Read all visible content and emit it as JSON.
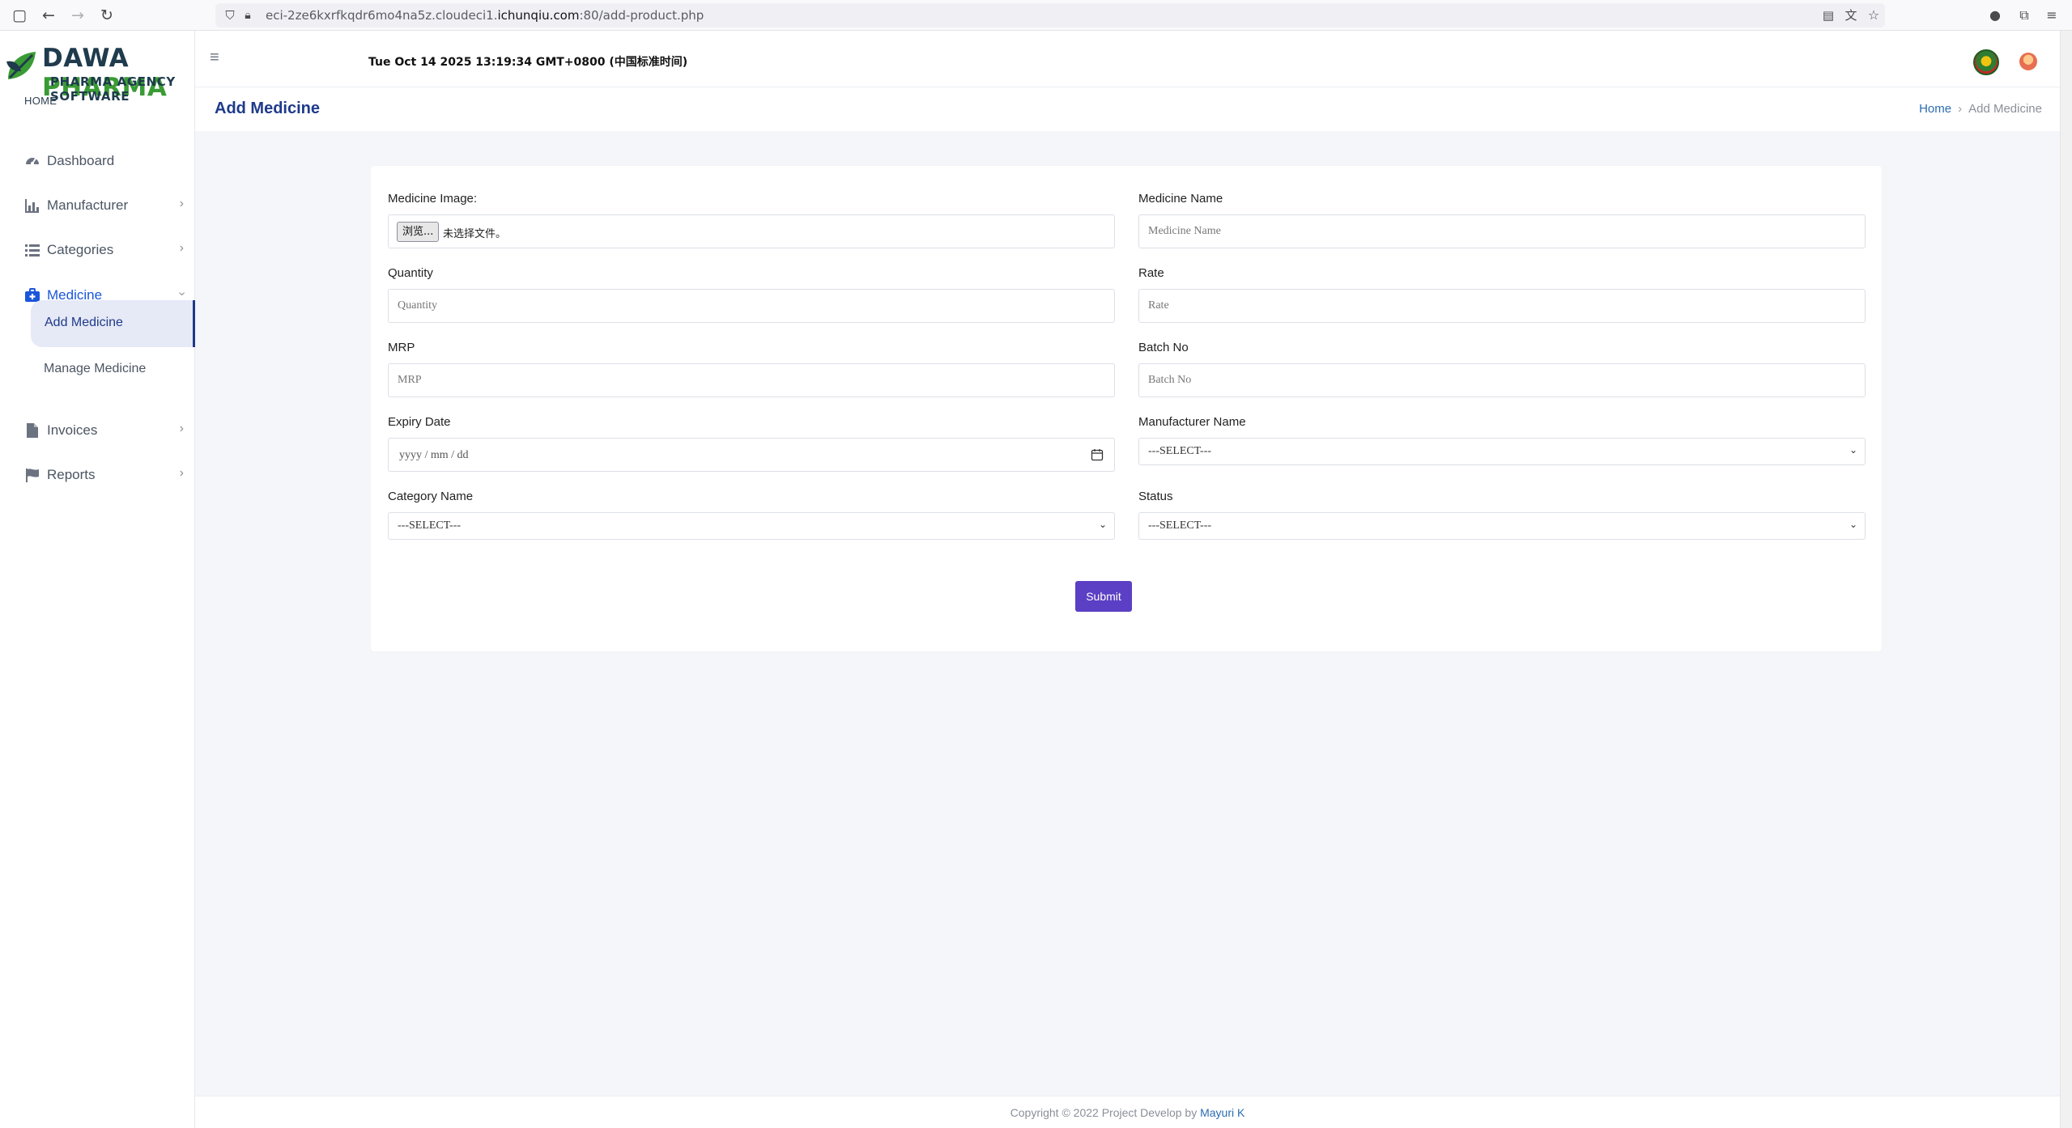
{
  "browser": {
    "url_prefix": "eci-2ze6kxrfkqdr6mo4na5z.cloudeci1.",
    "url_domain": "ichunqiu.com",
    "url_suffix": ":80/add-product.php"
  },
  "brand": {
    "name_part1": "DAWA",
    "name_part2": "PHARMA",
    "tagline": "PHARMA AGENCY SOFTWARE"
  },
  "header": {
    "datetime": "Tue Oct 14 2025 13:19:34 GMT+0800 (中国标准时间)"
  },
  "sidebar": {
    "heading": "HOME",
    "items": [
      {
        "label": "Dashboard",
        "icon": "dashboard-icon"
      },
      {
        "label": "Manufacturer",
        "icon": "chart-icon"
      },
      {
        "label": "Categories",
        "icon": "list-icon"
      },
      {
        "label": "Medicine",
        "icon": "medkit-icon"
      },
      {
        "label": "Invoices",
        "icon": "file-icon"
      },
      {
        "label": "Reports",
        "icon": "flag-icon"
      }
    ],
    "medicine_sub": [
      {
        "label": "Add Medicine"
      },
      {
        "label": "Manage Medicine"
      }
    ]
  },
  "page": {
    "title": "Add Medicine",
    "breadcrumb_home": "Home",
    "breadcrumb_current": "Add Medicine"
  },
  "form": {
    "image_label": "Medicine Image:",
    "file_button": "浏览...",
    "file_none": "未选择文件。",
    "name_label": "Medicine Name",
    "name_placeholder": "Medicine Name",
    "quantity_label": "Quantity",
    "quantity_placeholder": "Quantity",
    "rate_label": "Rate",
    "rate_placeholder": "Rate",
    "mrp_label": "MRP",
    "mrp_placeholder": "MRP",
    "batch_label": "Batch No",
    "batch_placeholder": "Batch No",
    "expiry_label": "Expiry Date",
    "expiry_placeholder": "yyyy / mm / dd",
    "manufacturer_label": "Manufacturer Name",
    "manufacturer_value": "---SELECT---",
    "category_label": "Category Name",
    "category_value": "---SELECT---",
    "status_label": "Status",
    "status_value": "---SELECT---",
    "submit_label": "Submit"
  },
  "footer": {
    "text": "Copyright © 2022 Project Develop by",
    "author": "Mayuri K"
  }
}
